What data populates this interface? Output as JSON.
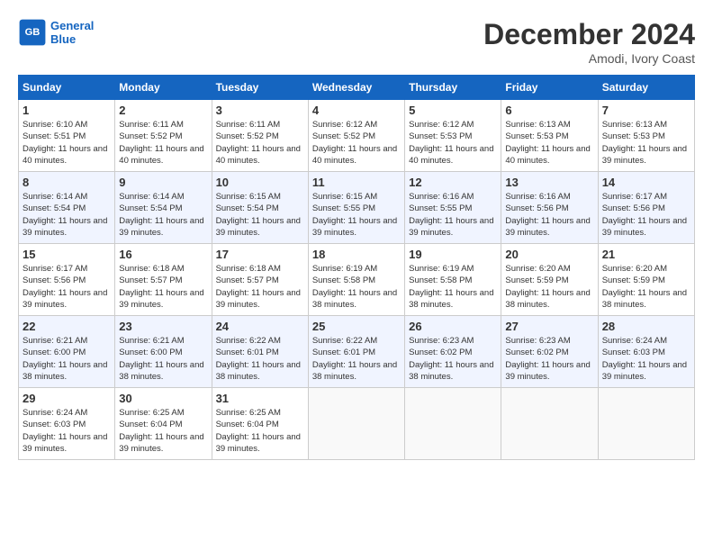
{
  "logo": {
    "line1": "General",
    "line2": "Blue"
  },
  "title": "December 2024",
  "location": "Amodi, Ivory Coast",
  "days_of_week": [
    "Sunday",
    "Monday",
    "Tuesday",
    "Wednesday",
    "Thursday",
    "Friday",
    "Saturday"
  ],
  "weeks": [
    [
      {
        "day": "1",
        "sunrise": "6:10 AM",
        "sunset": "5:51 PM",
        "daylight": "11 hours and 40 minutes."
      },
      {
        "day": "2",
        "sunrise": "6:11 AM",
        "sunset": "5:52 PM",
        "daylight": "11 hours and 40 minutes."
      },
      {
        "day": "3",
        "sunrise": "6:11 AM",
        "sunset": "5:52 PM",
        "daylight": "11 hours and 40 minutes."
      },
      {
        "day": "4",
        "sunrise": "6:12 AM",
        "sunset": "5:52 PM",
        "daylight": "11 hours and 40 minutes."
      },
      {
        "day": "5",
        "sunrise": "6:12 AM",
        "sunset": "5:53 PM",
        "daylight": "11 hours and 40 minutes."
      },
      {
        "day": "6",
        "sunrise": "6:13 AM",
        "sunset": "5:53 PM",
        "daylight": "11 hours and 40 minutes."
      },
      {
        "day": "7",
        "sunrise": "6:13 AM",
        "sunset": "5:53 PM",
        "daylight": "11 hours and 39 minutes."
      }
    ],
    [
      {
        "day": "8",
        "sunrise": "6:14 AM",
        "sunset": "5:54 PM",
        "daylight": "11 hours and 39 minutes."
      },
      {
        "day": "9",
        "sunrise": "6:14 AM",
        "sunset": "5:54 PM",
        "daylight": "11 hours and 39 minutes."
      },
      {
        "day": "10",
        "sunrise": "6:15 AM",
        "sunset": "5:54 PM",
        "daylight": "11 hours and 39 minutes."
      },
      {
        "day": "11",
        "sunrise": "6:15 AM",
        "sunset": "5:55 PM",
        "daylight": "11 hours and 39 minutes."
      },
      {
        "day": "12",
        "sunrise": "6:16 AM",
        "sunset": "5:55 PM",
        "daylight": "11 hours and 39 minutes."
      },
      {
        "day": "13",
        "sunrise": "6:16 AM",
        "sunset": "5:56 PM",
        "daylight": "11 hours and 39 minutes."
      },
      {
        "day": "14",
        "sunrise": "6:17 AM",
        "sunset": "5:56 PM",
        "daylight": "11 hours and 39 minutes."
      }
    ],
    [
      {
        "day": "15",
        "sunrise": "6:17 AM",
        "sunset": "5:56 PM",
        "daylight": "11 hours and 39 minutes."
      },
      {
        "day": "16",
        "sunrise": "6:18 AM",
        "sunset": "5:57 PM",
        "daylight": "11 hours and 39 minutes."
      },
      {
        "day": "17",
        "sunrise": "6:18 AM",
        "sunset": "5:57 PM",
        "daylight": "11 hours and 39 minutes."
      },
      {
        "day": "18",
        "sunrise": "6:19 AM",
        "sunset": "5:58 PM",
        "daylight": "11 hours and 38 minutes."
      },
      {
        "day": "19",
        "sunrise": "6:19 AM",
        "sunset": "5:58 PM",
        "daylight": "11 hours and 38 minutes."
      },
      {
        "day": "20",
        "sunrise": "6:20 AM",
        "sunset": "5:59 PM",
        "daylight": "11 hours and 38 minutes."
      },
      {
        "day": "21",
        "sunrise": "6:20 AM",
        "sunset": "5:59 PM",
        "daylight": "11 hours and 38 minutes."
      }
    ],
    [
      {
        "day": "22",
        "sunrise": "6:21 AM",
        "sunset": "6:00 PM",
        "daylight": "11 hours and 38 minutes."
      },
      {
        "day": "23",
        "sunrise": "6:21 AM",
        "sunset": "6:00 PM",
        "daylight": "11 hours and 38 minutes."
      },
      {
        "day": "24",
        "sunrise": "6:22 AM",
        "sunset": "6:01 PM",
        "daylight": "11 hours and 38 minutes."
      },
      {
        "day": "25",
        "sunrise": "6:22 AM",
        "sunset": "6:01 PM",
        "daylight": "11 hours and 38 minutes."
      },
      {
        "day": "26",
        "sunrise": "6:23 AM",
        "sunset": "6:02 PM",
        "daylight": "11 hours and 38 minutes."
      },
      {
        "day": "27",
        "sunrise": "6:23 AM",
        "sunset": "6:02 PM",
        "daylight": "11 hours and 39 minutes."
      },
      {
        "day": "28",
        "sunrise": "6:24 AM",
        "sunset": "6:03 PM",
        "daylight": "11 hours and 39 minutes."
      }
    ],
    [
      {
        "day": "29",
        "sunrise": "6:24 AM",
        "sunset": "6:03 PM",
        "daylight": "11 hours and 39 minutes."
      },
      {
        "day": "30",
        "sunrise": "6:25 AM",
        "sunset": "6:04 PM",
        "daylight": "11 hours and 39 minutes."
      },
      {
        "day": "31",
        "sunrise": "6:25 AM",
        "sunset": "6:04 PM",
        "daylight": "11 hours and 39 minutes."
      },
      null,
      null,
      null,
      null
    ]
  ]
}
